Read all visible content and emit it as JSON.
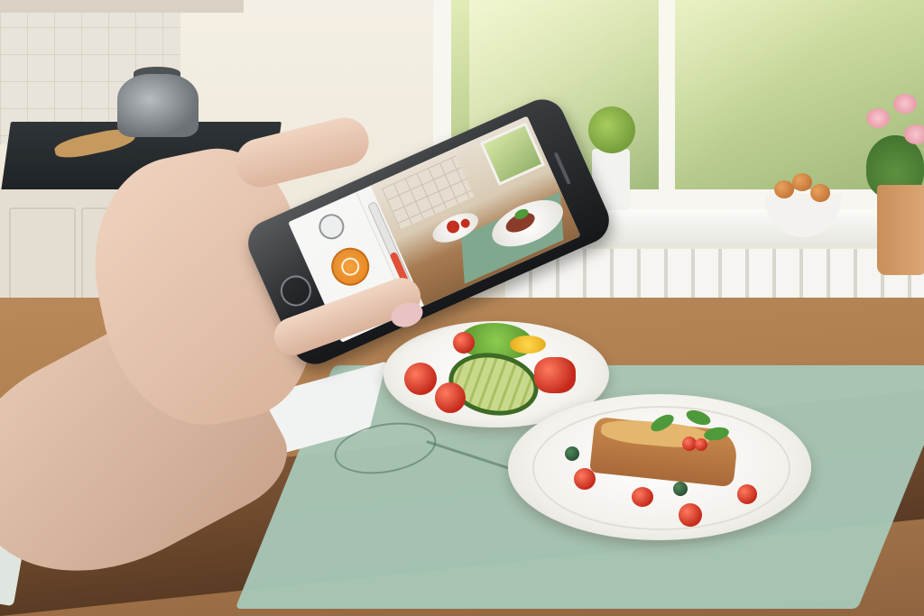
{
  "scene": {
    "kind": "photo-illustration",
    "subject": "hand-holding-smartphone-photographing-plated-food"
  },
  "camera_app": {
    "controls": [
      {
        "name": "shutter-button",
        "icon": "shutter-icon",
        "color": "#F29A36"
      },
      {
        "name": "mode-dial",
        "icon": "camera-mode-icon"
      },
      {
        "name": "switch-camera-button",
        "icon": "switch-camera-icon"
      },
      {
        "name": "zoom-slider",
        "icon": "slider-icon",
        "accent": "#E05238"
      }
    ]
  },
  "palette": {
    "placemat": "#A8C8B8",
    "table": "#A8784A",
    "window_light": "#C4D597"
  }
}
